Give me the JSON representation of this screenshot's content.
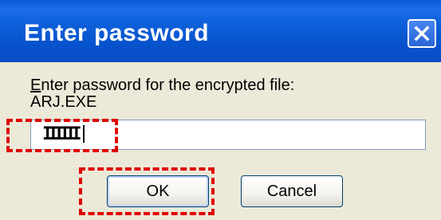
{
  "dialog": {
    "title": "Enter password",
    "close_icon": "close-x-icon"
  },
  "prompt": {
    "label_first": "E",
    "label_rest": "nter password for the encrypted file:",
    "filename": "ARJ.EXE"
  },
  "password_field": {
    "value": "IIIIII"
  },
  "buttons": {
    "ok_label": "OK",
    "cancel_label": "Cancel"
  },
  "colors": {
    "title_bar": "#0a5ad8",
    "dialog_body": "#ece9d8",
    "highlight": "#e00000"
  }
}
